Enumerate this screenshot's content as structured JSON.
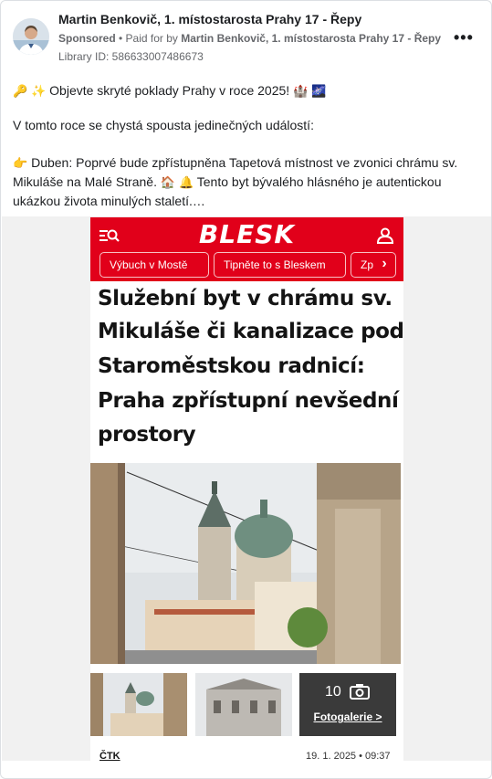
{
  "post": {
    "author": "Martin Benkovič, 1. místostarosta Prahy 17 - Řepy",
    "sponsored": "Sponsored",
    "paid_for_prefix": "• Paid for by",
    "paid_for_by": "Martin Benkovič, 1. místostarosta Prahy 17 - Řepy",
    "library_id": "Library ID: 586633007486673",
    "more_label": "•••"
  },
  "body": {
    "line1_emoji_a": "🔑",
    "line1_emoji_b": "✨",
    "line1": "Objevte skryté poklady Prahy v roce 2025!",
    "line1_emoji_c": "🏰",
    "line1_emoji_d": "🌌",
    "line2": "V tomto roce se chystá spousta jedinečných událostí:",
    "line3_emoji": "👉",
    "line3": "Duben: Poprvé bude zpřístupněna Tapetová místnost ve zvonici chrámu sv.",
    "line4_a": "Mikuláše na Malé Straně.",
    "line4_emoji_a": "🏠",
    "line4_emoji_b": "🔔",
    "line4_b": "Tento byt bývalého hlásného je autentickou",
    "line5": "ukázkou života minulých staletí.…"
  },
  "article": {
    "logo": "BLESK",
    "pills": [
      "Výbuch v Mostě",
      "Tipněte to s Bleskem",
      "Zp"
    ],
    "pill_arrow": "›",
    "headline_lines": [
      "Služební byt v chrámu sv.",
      "Mikuláše či kanalizace pod",
      "Staroměstskou radnicí:",
      "Praha zpřístupní nevšední",
      "prostory"
    ],
    "gallery_count": "10",
    "gallery_label": "Fotogalerie >",
    "source": "ČTK",
    "date": "19. 1. 2025 • 09:37"
  },
  "colors": {
    "blesk_red": "#e1001a",
    "meta_grey": "#65676b"
  },
  "icons": [
    "avatar-photo",
    "more-dots-icon",
    "menu-search-icon",
    "user-icon",
    "camera-icon"
  ]
}
